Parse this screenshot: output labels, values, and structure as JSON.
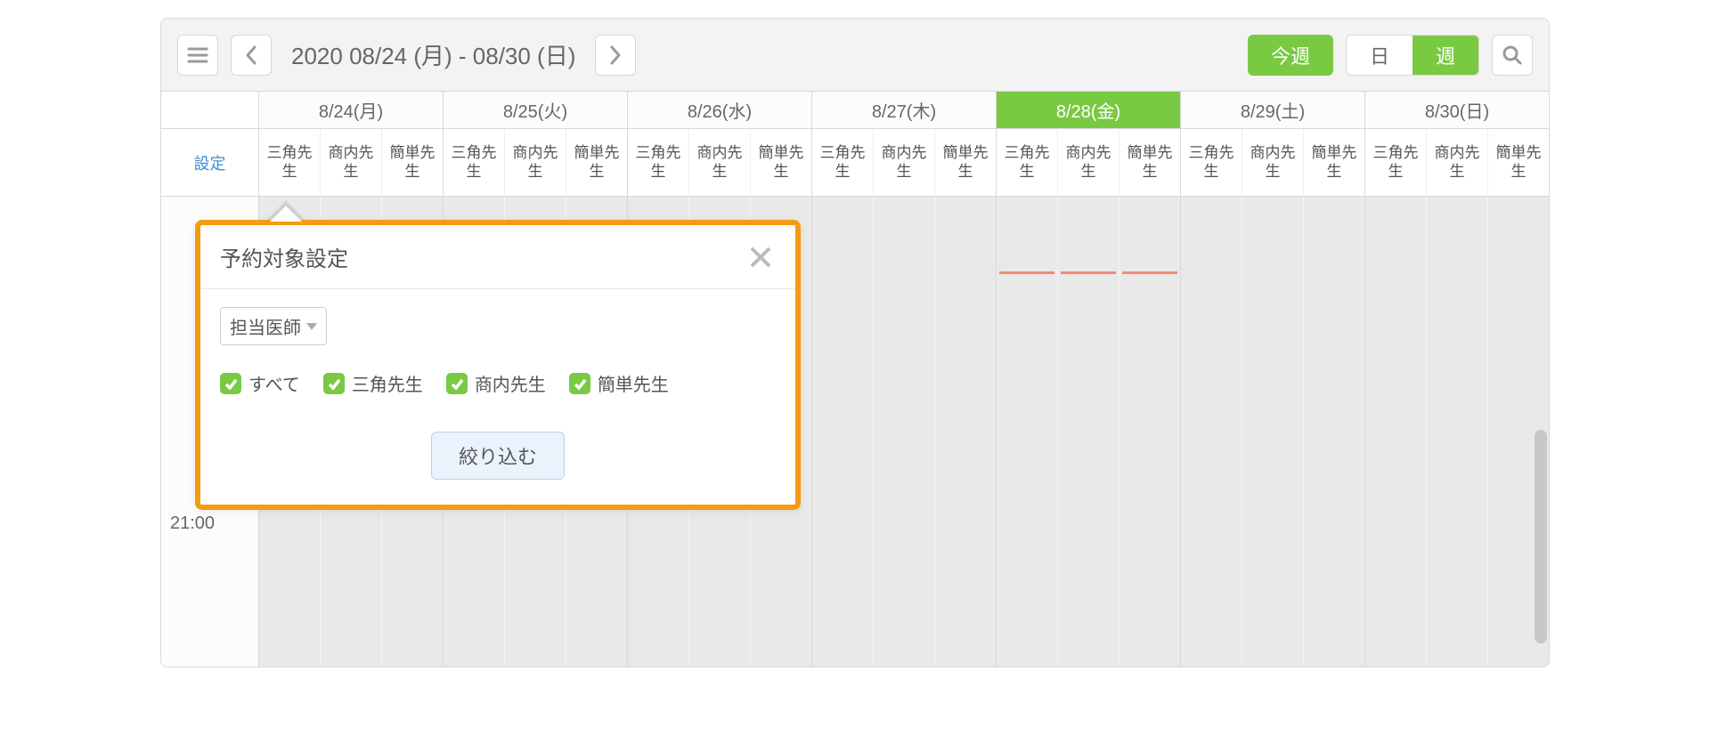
{
  "toolbar": {
    "date_range": "2020 08/24 (月) - 08/30 (日)",
    "today_btn": "今週",
    "view_day": "日",
    "view_week": "週"
  },
  "days": [
    {
      "label": "8/24(月)",
      "today": false
    },
    {
      "label": "8/25(火)",
      "today": false
    },
    {
      "label": "8/26(水)",
      "today": false
    },
    {
      "label": "8/27(木)",
      "today": false
    },
    {
      "label": "8/28(金)",
      "today": true
    },
    {
      "label": "8/29(土)",
      "today": false
    },
    {
      "label": "8/30(日)",
      "today": false
    }
  ],
  "settings_label": "設定",
  "staff": [
    "三角先生",
    "商内先生",
    "簡単先生"
  ],
  "time_label_visible": "21:00",
  "modal": {
    "title": "予約対象設定",
    "select_label": "担当医師",
    "check_all": "すべて",
    "checks": [
      "三角先生",
      "商内先生",
      "簡単先生"
    ],
    "filter_btn": "絞り込む"
  }
}
